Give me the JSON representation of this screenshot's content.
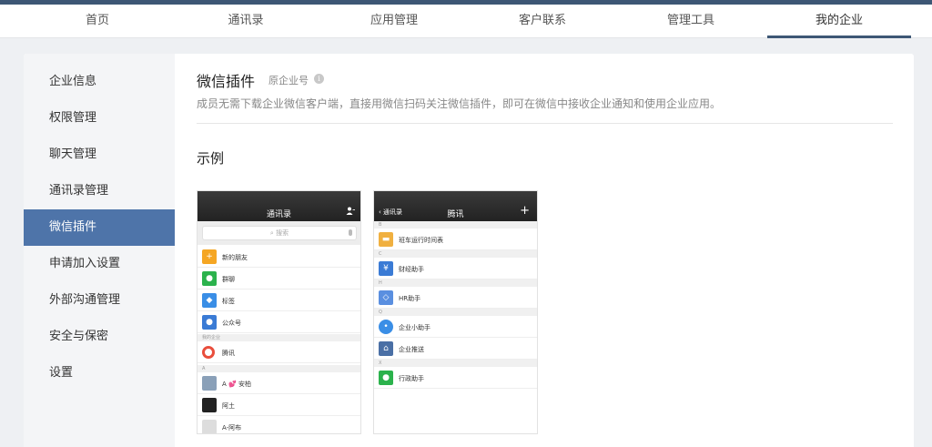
{
  "nav": {
    "items": [
      {
        "label": "首页",
        "active": false
      },
      {
        "label": "通讯录",
        "active": false
      },
      {
        "label": "应用管理",
        "active": false
      },
      {
        "label": "客户联系",
        "active": false
      },
      {
        "label": "管理工具",
        "active": false
      },
      {
        "label": "我的企业",
        "active": true
      }
    ]
  },
  "sidebar": {
    "items": [
      {
        "label": "企业信息"
      },
      {
        "label": "权限管理"
      },
      {
        "label": "聊天管理"
      },
      {
        "label": "通讯录管理"
      },
      {
        "label": "微信插件",
        "active": true
      },
      {
        "label": "申请加入设置"
      },
      {
        "label": "外部沟通管理"
      },
      {
        "label": "安全与保密"
      },
      {
        "label": "设置"
      }
    ]
  },
  "main": {
    "title": "微信插件",
    "subtitle": "原企业号",
    "info_icon": "info-icon",
    "description": "成员无需下载企业微信客户端，直接用微信扫码关注微信插件，即可在微信中接收企业通知和使用企业应用。",
    "section_title": "示例"
  },
  "phone1": {
    "title": "通讯录",
    "search": "搜索",
    "rows": [
      {
        "label": "新的朋友",
        "color": "#f5a623",
        "icon": "add-friend-icon"
      },
      {
        "label": "群聊",
        "color": "#2bb24c",
        "icon": "group-chat-icon"
      },
      {
        "label": "标签",
        "color": "#3a8ee6",
        "icon": "tag-icon"
      },
      {
        "label": "公众号",
        "color": "#3a7bd5",
        "icon": "official-account-icon"
      }
    ],
    "group_label": "我的企业",
    "company": {
      "label": "腾讯",
      "icon": "tencent-logo"
    },
    "letter": "A",
    "contacts": [
      {
        "label": "A 💕 安柏"
      },
      {
        "label": "阿土"
      },
      {
        "label": "A-阿布"
      }
    ]
  },
  "phone2": {
    "back": "通讯录",
    "title": "腾讯",
    "right": "+",
    "groups": [
      "B",
      "C",
      "H",
      "Q",
      "X"
    ],
    "rows": [
      {
        "label": "班车运行时间表",
        "color": "#f0b040",
        "icon": "bus-icon"
      },
      {
        "label": "财经助手",
        "color": "#3a7bd5",
        "icon": "yen-icon"
      },
      {
        "label": "HR助手",
        "color": "#5a8fe0",
        "icon": "hr-icon"
      },
      {
        "label": "企业小助手",
        "color": "#3a8ee6",
        "icon": "assistant-icon"
      },
      {
        "label": "企业推送",
        "color": "#4a6fa5",
        "icon": "home-icon"
      },
      {
        "label": "行政助手",
        "color": "#2bb24c",
        "icon": "admin-icon"
      }
    ]
  }
}
